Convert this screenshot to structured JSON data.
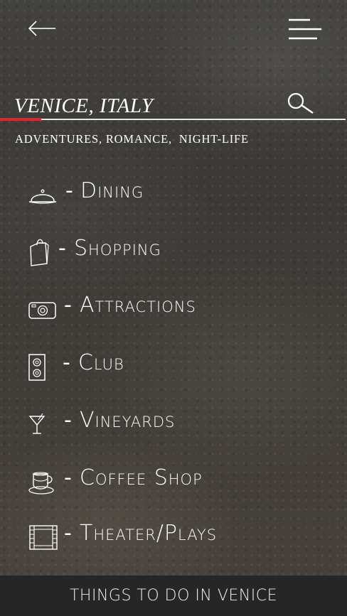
{
  "header": {
    "back_icon": "arrow-left-icon",
    "menu_icon": "hamburger-menu-icon"
  },
  "search": {
    "value": "VENICE, ITALY",
    "search_icon": "search-icon",
    "accent_color": "#e0262b"
  },
  "tagline": "ADVENTURES, ROMANCE,  NIGHT-LIFE",
  "categories": [
    {
      "label": "Dining",
      "icon": "cloche-icon"
    },
    {
      "label": "Shopping",
      "icon": "shopping-bag-icon"
    },
    {
      "label": "Attractions",
      "icon": "camera-icon"
    },
    {
      "label": "Club",
      "icon": "speaker-icon"
    },
    {
      "label": "Vineyards",
      "icon": "cocktail-glass-icon"
    },
    {
      "label": "Coffee Shop",
      "icon": "coffee-cup-icon"
    },
    {
      "label": "Theater/Plays",
      "icon": "film-strip-icon"
    }
  ],
  "dash": "-",
  "footer": {
    "title": "THINGS TO DO IN VENICE"
  }
}
